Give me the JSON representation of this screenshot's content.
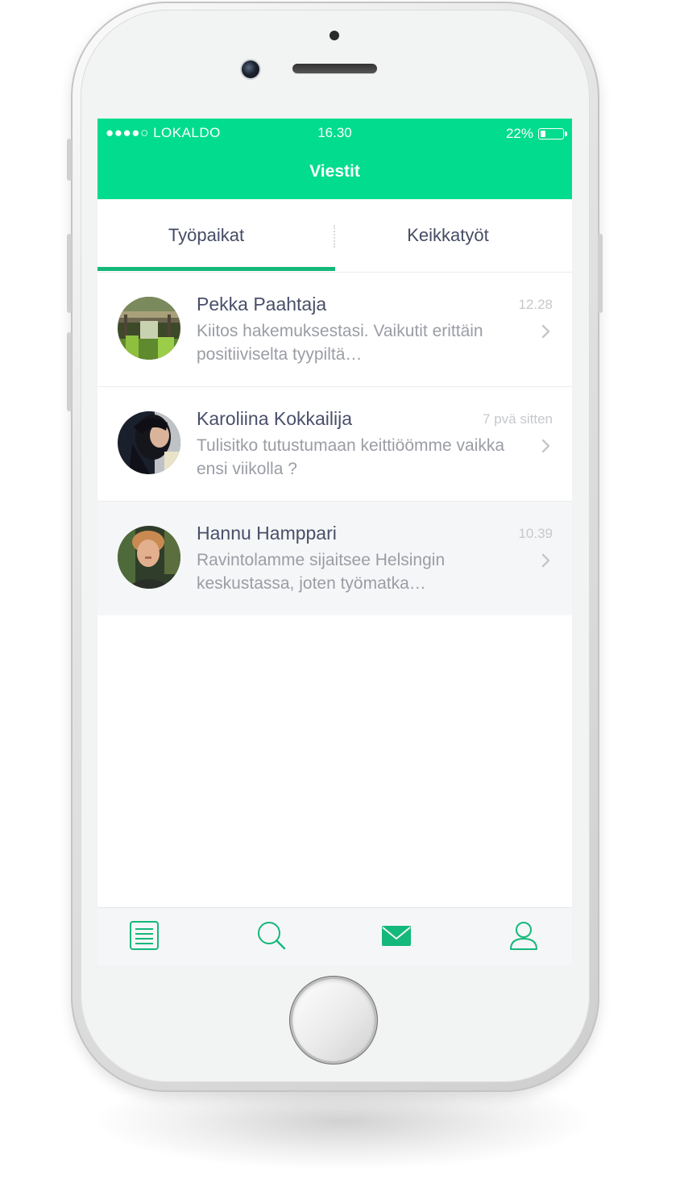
{
  "status_bar": {
    "carrier": "●●●●○ LOKALDO",
    "time": "16.30",
    "battery": "22%",
    "battery_level": 0.22
  },
  "header": {
    "title": "Viestit"
  },
  "tabs": [
    {
      "label": "Työpaikat",
      "active": true
    },
    {
      "label": "Keikkatyöt",
      "active": false
    }
  ],
  "conversations": [
    {
      "name": "Pekka Paahtaja",
      "time": "12.28",
      "message": "Kiitos hakemuksestasi. Vaikutit erittäin positiiviselta tyypiltä…",
      "avatar": "dock-photo-avatar"
    },
    {
      "name": "Karoliina Kokkailija",
      "time": "7 pvä sitten",
      "message": "Tulisitko tutustumaan keittiöömme vaikka ensi viikolla ?",
      "avatar": "woman-photo-avatar"
    },
    {
      "name": "Hannu Hamppari",
      "time": "10.39",
      "message": "Ravintolamme sijaitsee Helsingin keskustassa, joten työmatka…",
      "avatar": "man-photo-avatar"
    }
  ],
  "tab_bar": [
    {
      "icon": "list-icon",
      "active": false
    },
    {
      "icon": "search-icon",
      "active": false
    },
    {
      "icon": "mail-icon",
      "active": true
    },
    {
      "icon": "profile-icon",
      "active": false
    }
  ],
  "colors": {
    "header_green": "#02dc8e",
    "accent_green": "#14b87a",
    "name_text": "#4a4f6a",
    "message_text": "#9a9da4"
  }
}
